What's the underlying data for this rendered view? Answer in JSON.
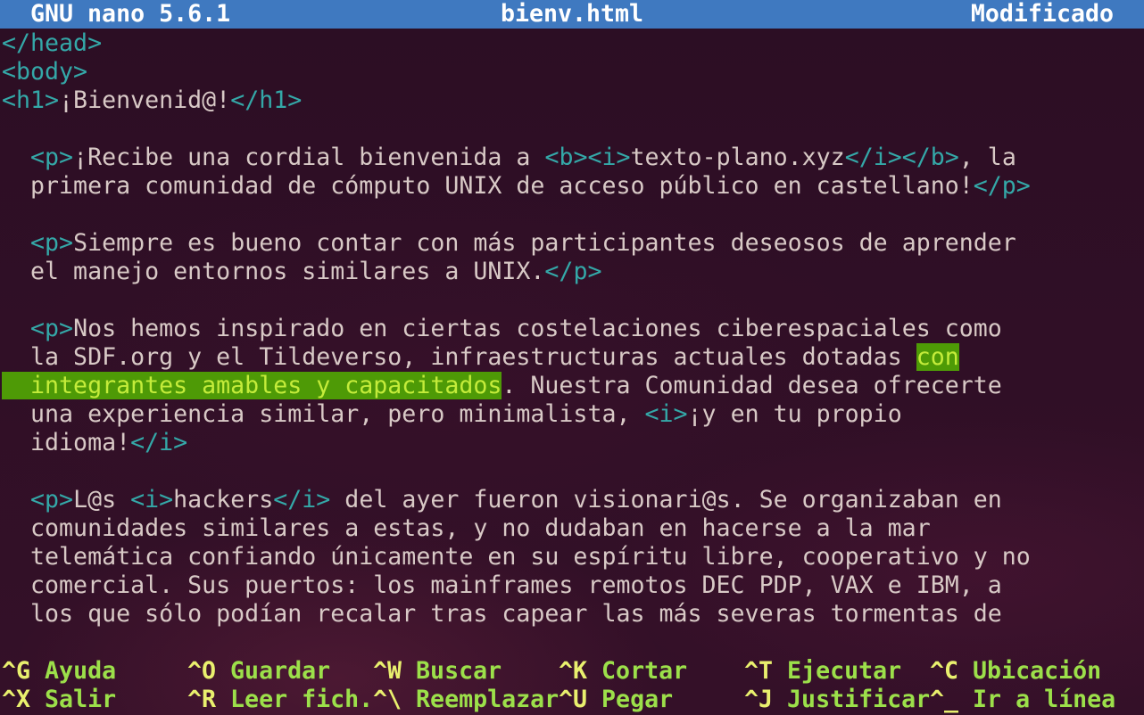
{
  "title_bar": {
    "app_version": "GNU nano 5.6.1",
    "file_name": "bienv.html",
    "status": "Modificado"
  },
  "editor": {
    "lines": [
      [
        {
          "t": "</head>",
          "c": "tag"
        }
      ],
      [
        {
          "t": "<body>",
          "c": "tag"
        }
      ],
      [
        {
          "t": "<h1>",
          "c": "tag"
        },
        {
          "t": "¡Bienvenid@!"
        },
        {
          "t": "</h1>",
          "c": "tag"
        }
      ],
      [],
      [
        {
          "t": "  "
        },
        {
          "t": "<p>",
          "c": "tag"
        },
        {
          "t": "¡Recibe una cordial bienvenida a "
        },
        {
          "t": "<b><i>",
          "c": "tag"
        },
        {
          "t": "texto-plano.xyz"
        },
        {
          "t": "</i></b>",
          "c": "tag"
        },
        {
          "t": ", la"
        }
      ],
      [
        {
          "t": "  primera comunidad de cómputo UNIX de acceso público en castellano!"
        },
        {
          "t": "</p>",
          "c": "tag"
        }
      ],
      [],
      [
        {
          "t": "  "
        },
        {
          "t": "<p>",
          "c": "tag"
        },
        {
          "t": "Siempre es bueno contar con más participantes deseosos de aprender"
        }
      ],
      [
        {
          "t": "  el manejo entornos similares a UNIX."
        },
        {
          "t": "</p>",
          "c": "tag"
        }
      ],
      [],
      [
        {
          "t": "  "
        },
        {
          "t": "<p>",
          "c": "tag"
        },
        {
          "t": "Nos hemos inspirado en ciertas costelaciones ciberespaciales como"
        }
      ],
      [
        {
          "t": "  la SDF.org y el Tildeverso, infraestructuras actuales dotadas "
        },
        {
          "t": "con",
          "c": "hl"
        }
      ],
      [
        {
          "t": "  integrantes amables y capacitados",
          "c": "hl"
        },
        {
          "t": ". Nuestra Comunidad desea ofrecerte"
        }
      ],
      [
        {
          "t": "  una experiencia similar, pero minimalista, "
        },
        {
          "t": "<i>",
          "c": "tag"
        },
        {
          "t": "¡y en tu propio"
        }
      ],
      [
        {
          "t": "  idioma!"
        },
        {
          "t": "</i>",
          "c": "tag"
        }
      ],
      [],
      [
        {
          "t": "  "
        },
        {
          "t": "<p>",
          "c": "tag"
        },
        {
          "t": "L@s "
        },
        {
          "t": "<i>",
          "c": "tag"
        },
        {
          "t": "hackers"
        },
        {
          "t": "</i>",
          "c": "tag"
        },
        {
          "t": " del ayer fueron visionari@s. Se organizaban en"
        }
      ],
      [
        {
          "t": "  comunidades similares a estas, y no dudaban en hacerse a la mar"
        }
      ],
      [
        {
          "t": "  telemática confiando únicamente en su espíritu libre, cooperativo y no"
        }
      ],
      [
        {
          "t": "  comercial. Sus puertos: los mainframes remotos DEC PDP, VAX e IBM, a"
        }
      ],
      [
        {
          "t": "  los que sólo podían recalar tras capear las más severas tormentas de"
        }
      ]
    ]
  },
  "shortcuts": [
    [
      {
        "key": "^G",
        "label": "Ayuda"
      },
      {
        "key": "^O",
        "label": "Guardar"
      },
      {
        "key": "^W",
        "label": "Buscar"
      },
      {
        "key": "^K",
        "label": "Cortar"
      },
      {
        "key": "^T",
        "label": "Ejecutar"
      },
      {
        "key": "^C",
        "label": "Ubicación"
      }
    ],
    [
      {
        "key": "^X",
        "label": "Salir"
      },
      {
        "key": "^R",
        "label": "Leer fich."
      },
      {
        "key": "^\\",
        "label": "Reemplazar"
      },
      {
        "key": "^U",
        "label": "Pegar"
      },
      {
        "key": "^J",
        "label": "Justificar"
      },
      {
        "key": "^_",
        "label": "Ir a línea"
      }
    ]
  ]
}
